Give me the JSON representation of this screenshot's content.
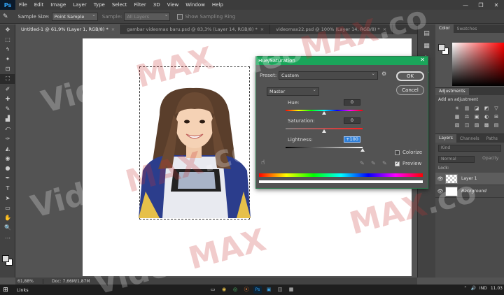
{
  "menu": {
    "logo": "Ps",
    "items": [
      "File",
      "Edit",
      "Image",
      "Layer",
      "Type",
      "Select",
      "Filter",
      "3D",
      "View",
      "Window",
      "Help"
    ],
    "window_controls": [
      "—",
      "❐",
      "✕"
    ]
  },
  "options_bar": {
    "sample_size_label": "Sample Size:",
    "sample_size_value": "Point Sample",
    "sample_label": "Sample:",
    "sample_value": "All Layers",
    "show_ring_label": "Show Sampling Ring"
  },
  "tabs": [
    {
      "label": "Untitled-1 @ 61,9% (Layer 1, RGB/8) *",
      "close": "×"
    },
    {
      "label": "gambar videomax baru.psd @ 83,3% (Layer 14, RGB/8) *",
      "close": "×"
    },
    {
      "label": "videomax22.psd @ 100% (Layer 14, RGB/8) *",
      "close": "×"
    }
  ],
  "tools": [
    "✥",
    "⬚",
    "ϟ",
    "✦",
    "⊡",
    "⛶",
    "✐",
    "✚",
    "✎",
    "▟",
    "⤺",
    "✑",
    "◭",
    "◉",
    "●",
    "✒",
    "T",
    "➤",
    "▭",
    "✋",
    "🔍",
    "⋯"
  ],
  "status": {
    "zoom": "61,88%",
    "doc": "Doc: 7,66M/1,87M"
  },
  "panels": {
    "color_tabs": [
      "Color",
      "Swatches"
    ],
    "adjustments_tab": "Adjustments",
    "add_adjustment": "Add an adjustment",
    "adj_icons": [
      "☀",
      "▥",
      "◪",
      "◩",
      "▽",
      "",
      "▦",
      "⚖",
      "▣",
      "◐",
      "⊞",
      "",
      "▧",
      "◫",
      "▨",
      "▩",
      "▤",
      ""
    ],
    "layer_tabs": [
      "Layers",
      "Channels",
      "Paths"
    ],
    "kind_placeholder": "Kind",
    "blend_mode": "Normal",
    "opacity_label": "Opacity",
    "lock_label": "Lock:",
    "layers": [
      {
        "name": "Layer 1",
        "selected": true,
        "italic": false
      },
      {
        "name": "Background",
        "selected": false,
        "italic": true
      }
    ],
    "footer_icons": [
      "⊕",
      "fx",
      "◧",
      "◑",
      "▣",
      "⊞",
      "🗑"
    ]
  },
  "dialog": {
    "title": "Hue/Saturation",
    "close": "✕",
    "preset_label": "Preset:",
    "preset_value": "Custom",
    "channel_value": "Master",
    "hue_label": "Hue:",
    "hue_value": "0",
    "saturation_label": "Saturation:",
    "saturation_value": "0",
    "lightness_label": "Lightness:",
    "lightness_value": "+100",
    "ok": "OK",
    "cancel": "Cancel",
    "colorize_label": "Colorize",
    "preview_label": "Preview",
    "hue_pos": 0.5,
    "saturation_pos": 0.5,
    "lightness_pos": 1.0
  },
  "watermark": {
    "prefix": "Video",
    "max": "MAX",
    "suffix": ".co"
  },
  "taskbar": {
    "start": "⊞",
    "links": "Links",
    "task_icons": [
      "▭",
      "◉",
      "◎",
      "⦿",
      "Ps",
      "▣",
      "◫",
      "▦"
    ],
    "tray": [
      "⌃",
      "🔊",
      "IND",
      "11.03"
    ]
  }
}
